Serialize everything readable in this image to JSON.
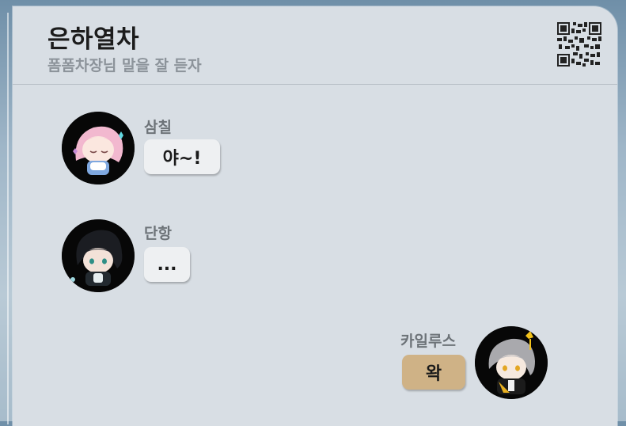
{
  "header": {
    "title": "은하열차",
    "subtitle": "폼폼차장님 말을 잘 듣자"
  },
  "messages": [
    {
      "sender": "삼칠",
      "text": "야~!",
      "side": "left"
    },
    {
      "sender": "단항",
      "text": "...",
      "side": "left"
    },
    {
      "sender": "카일루스",
      "text": "왁",
      "side": "right"
    }
  ],
  "colors": {
    "card_bg": "#d8dee4",
    "bubble_bg": "#eef0f2",
    "self_bubble_bg": "#cfb286",
    "avatar_bg": "#070707"
  },
  "icons": [
    "qr-code-icon"
  ]
}
